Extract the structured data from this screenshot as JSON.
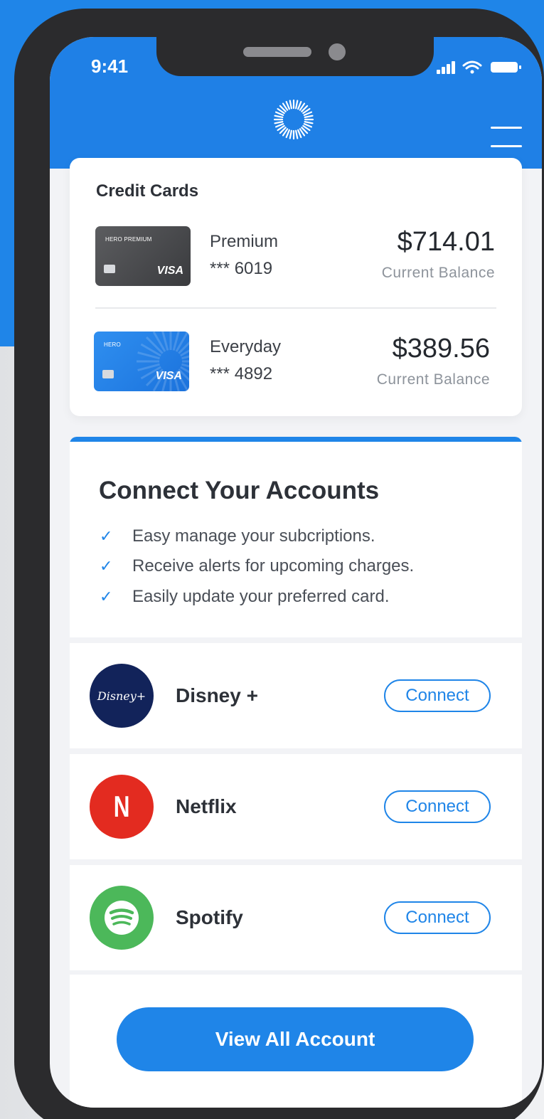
{
  "status_bar": {
    "time": "9:41"
  },
  "colors": {
    "brand_blue": "#1f85e8",
    "card_dark": "#4a4b4e",
    "disney": "#12235a",
    "netflix": "#e32b20",
    "spotify": "#4cb85a"
  },
  "header": {
    "logo_icon": "sunburst-logo-icon",
    "menu_icon": "hamburger-menu-icon"
  },
  "credit_cards": {
    "title": "Credit Cards",
    "cards": [
      {
        "brand": "HERO PREMIUM",
        "network": "VISA",
        "name": "Premium",
        "number": "*** 6019",
        "amount": "$714.01",
        "label": "Current Balance"
      },
      {
        "brand": "HERO",
        "network": "VISA",
        "name": "Everyday",
        "number": "*** 4892",
        "amount": "$389.56",
        "label": "Current Balance"
      }
    ]
  },
  "connect": {
    "title": "Connect Your Accounts",
    "benefits": [
      "Easy manage your subcriptions.",
      "Receive alerts for upcoming charges.",
      "Easily update your preferred card."
    ]
  },
  "services": [
    {
      "name": "Disney +",
      "button": "Connect",
      "logo_text": "Disney+"
    },
    {
      "name": "Netflix",
      "button": "Connect",
      "logo_text": "N"
    },
    {
      "name": "Spotify",
      "button": "Connect"
    }
  ],
  "footer": {
    "view_all": "View All Account"
  }
}
